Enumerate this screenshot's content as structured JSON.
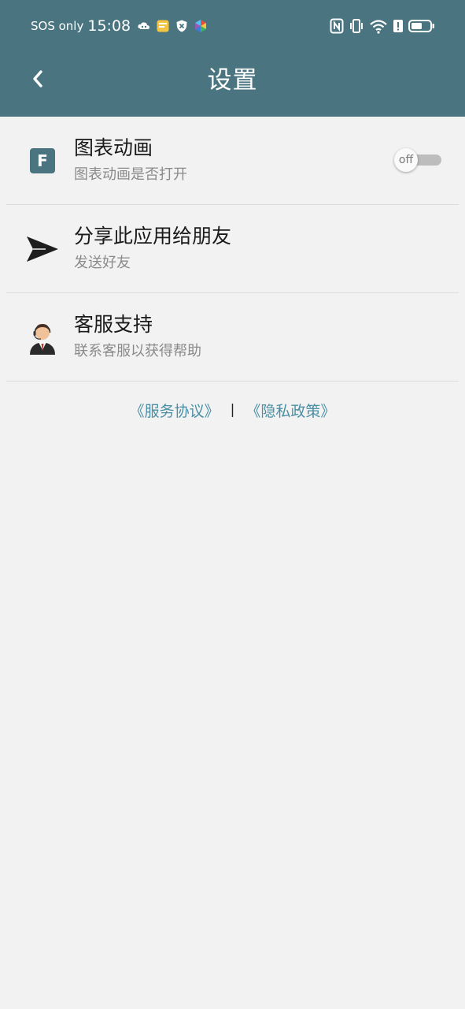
{
  "status_bar": {
    "sos": "SOS only",
    "time": "15:08",
    "notification_icons": [
      "cloud-gamepad-icon",
      "note-app-icon",
      "shield-x-icon",
      "colorful-app-icon"
    ],
    "system_icons": [
      "nfc-icon",
      "vibrate-icon",
      "wifi-icon",
      "alert-icon",
      "battery-icon"
    ]
  },
  "app_bar": {
    "title": "设置",
    "back_icon": "chevron-left-icon"
  },
  "settings": [
    {
      "title": "图表动画",
      "subtitle": "图表动画是否打开",
      "icon": "f-square-icon",
      "toggle": {
        "label": "off",
        "on": false
      }
    },
    {
      "title": "分享此应用给朋友",
      "subtitle": "发送好友",
      "icon": "send-icon"
    },
    {
      "title": "客服支持",
      "subtitle": "联系客服以获得帮助",
      "icon": "support-agent-icon"
    }
  ],
  "footer": {
    "terms": "《服务协议》",
    "separator": "|",
    "privacy": "《隐私政策》"
  },
  "colors": {
    "header_bg": "#4a7580",
    "page_bg": "#f2f2f2",
    "link": "#4a8fa4"
  }
}
